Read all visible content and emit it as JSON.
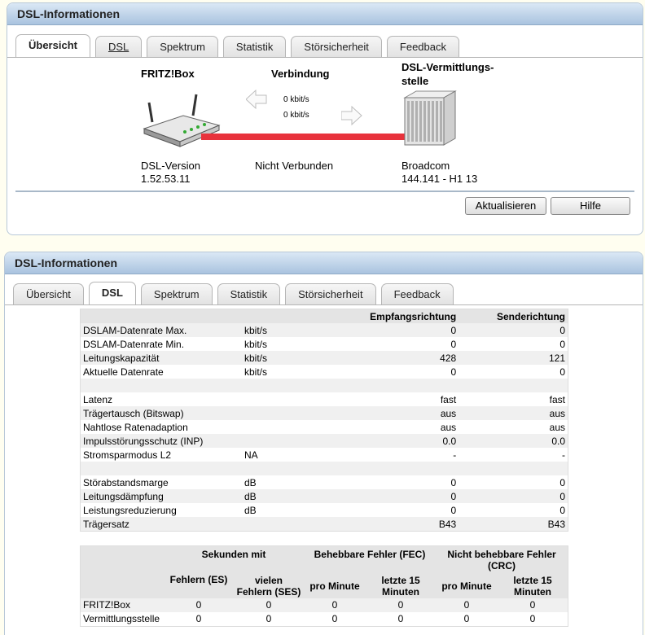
{
  "panel1": {
    "title": "DSL-Informationen",
    "tabs": [
      "Übersicht",
      "DSL",
      "Spektrum",
      "Statistik",
      "Störsicherheit",
      "Feedback"
    ],
    "fritzbox_label": "FRITZ!Box",
    "connection_label": "Verbindung",
    "exchange_label_1": "DSL-Vermittlungs-",
    "exchange_label_2": "stelle",
    "upstream_rate": "0 kbit/s",
    "downstream_rate": "0 kbit/s",
    "dsl_version_label": "DSL-Version",
    "dsl_version_value": "1.52.53.11",
    "status": "Nicht Verbunden",
    "chip_vendor": "Broadcom",
    "chip_version": "144.141 - H1 13",
    "refresh_button": "Aktualisieren",
    "help_button": "Hilfe"
  },
  "panel2": {
    "title": "DSL-Informationen",
    "tabs": [
      "Übersicht",
      "DSL",
      "Spektrum",
      "Statistik",
      "Störsicherheit",
      "Feedback"
    ],
    "table_headers": {
      "rx": "Empfangsrichtung",
      "tx": "Senderichtung"
    },
    "rows": [
      {
        "label": "DSLAM-Datenrate Max.",
        "unit": "kbit/s",
        "rx": "0",
        "tx": "0"
      },
      {
        "label": "DSLAM-Datenrate Min.",
        "unit": "kbit/s",
        "rx": "0",
        "tx": "0"
      },
      {
        "label": "Leitungskapazität",
        "unit": "kbit/s",
        "rx": "428",
        "tx": "121"
      },
      {
        "label": "Aktuelle Datenrate",
        "unit": "kbit/s",
        "rx": "0",
        "tx": "0"
      },
      {
        "label": "",
        "unit": "",
        "rx": "",
        "tx": ""
      },
      {
        "label": "Latenz",
        "unit": "",
        "rx": "fast",
        "tx": "fast"
      },
      {
        "label": "Trägertausch (Bitswap)",
        "unit": "",
        "rx": "aus",
        "tx": "aus"
      },
      {
        "label": "Nahtlose Ratenadaption",
        "unit": "",
        "rx": "aus",
        "tx": "aus"
      },
      {
        "label": "Impulsstörungsschutz (INP)",
        "unit": "",
        "rx": "0.0",
        "tx": "0.0"
      },
      {
        "label": "Stromsparmodus L2",
        "unit": "NA",
        "rx": "-",
        "tx": "-"
      },
      {
        "label": "",
        "unit": "",
        "rx": "",
        "tx": ""
      },
      {
        "label": "Störabstandsmarge",
        "unit": "dB",
        "rx": "0",
        "tx": "0"
      },
      {
        "label": "Leitungsdämpfung",
        "unit": "dB",
        "rx": "0",
        "tx": "0"
      },
      {
        "label": "Leistungsreduzierung",
        "unit": "dB",
        "rx": "0",
        "tx": "0"
      },
      {
        "label": "Trägersatz",
        "unit": "",
        "rx": "B43",
        "tx": "B43"
      }
    ],
    "errors": {
      "group_seconds": "Sekunden mit",
      "group_fec": "Behebbare Fehler (FEC)",
      "group_crc": "Nicht behebbare Fehler (CRC)",
      "sub_es": "Fehlern (ES)",
      "sub_ses": "vielen Fehlern (SES)",
      "sub_pro_minute": "pro Minute",
      "sub_last_15": "letzte 15 Minuten",
      "rows": [
        {
          "label": "FRITZ!Box",
          "values": [
            "0",
            "0",
            "0",
            "0",
            "0",
            "0"
          ]
        },
        {
          "label": "Vermittlungsstelle",
          "values": [
            "0",
            "0",
            "0",
            "0",
            "0",
            "0"
          ]
        }
      ]
    }
  },
  "colors": {
    "line": "#e8323c",
    "title_bar": "#a9c3df",
    "background": "#fffef0"
  }
}
